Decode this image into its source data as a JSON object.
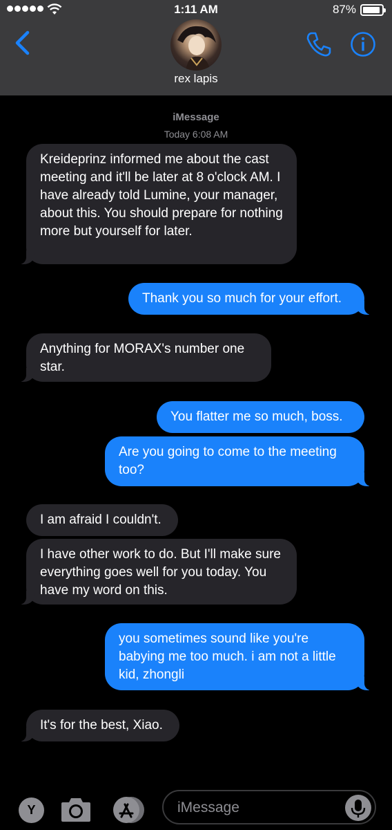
{
  "status_bar": {
    "time": "1:11 AM",
    "battery_percent": "87%",
    "battery_level": 0.87,
    "signal_bars": 5
  },
  "header": {
    "contact_name": "rex lapis",
    "back_icon": "chevron-left-icon",
    "call_icon": "phone-icon",
    "info_icon": "info-icon"
  },
  "conversation": {
    "service": "iMessage",
    "timestamp": "Today 6:08 AM",
    "messages": [
      {
        "from": "contact",
        "text": "Kreideprinz informed me about the cast meeting and it'll be later at 8 o'clock AM. I have already told Lumine, your manager, about this. You should prepare for nothing more but yourself for later."
      },
      {
        "from": "me",
        "text": "Thank you so much for your effort."
      },
      {
        "from": "contact",
        "text": "Anything for MORAX's number one star."
      },
      {
        "from": "me",
        "text": "You flatter me so much, boss."
      },
      {
        "from": "me",
        "text": "Are you going to come to the meeting too?"
      },
      {
        "from": "contact",
        "text": "I am afraid I couldn't."
      },
      {
        "from": "contact",
        "text": "I have other work to do. But I'll make sure everything goes well for you today. You have my word on this."
      },
      {
        "from": "me",
        "text": "you sometimes sound like you're babying me too much. i am not a little kid, zhongli"
      },
      {
        "from": "contact",
        "text": "It's for the best, Xiao."
      }
    ]
  },
  "composer": {
    "app_badge_letter": "Y",
    "placeholder": "iMessage",
    "camera_icon": "camera-icon",
    "apps_icon": "app-store-icon",
    "mic_icon": "microphone-icon"
  },
  "colors": {
    "outgoing_bubble": "#1a82fb",
    "incoming_bubble": "#26252a",
    "accent": "#1a82fb",
    "header_bg": "#3b3b3d"
  }
}
